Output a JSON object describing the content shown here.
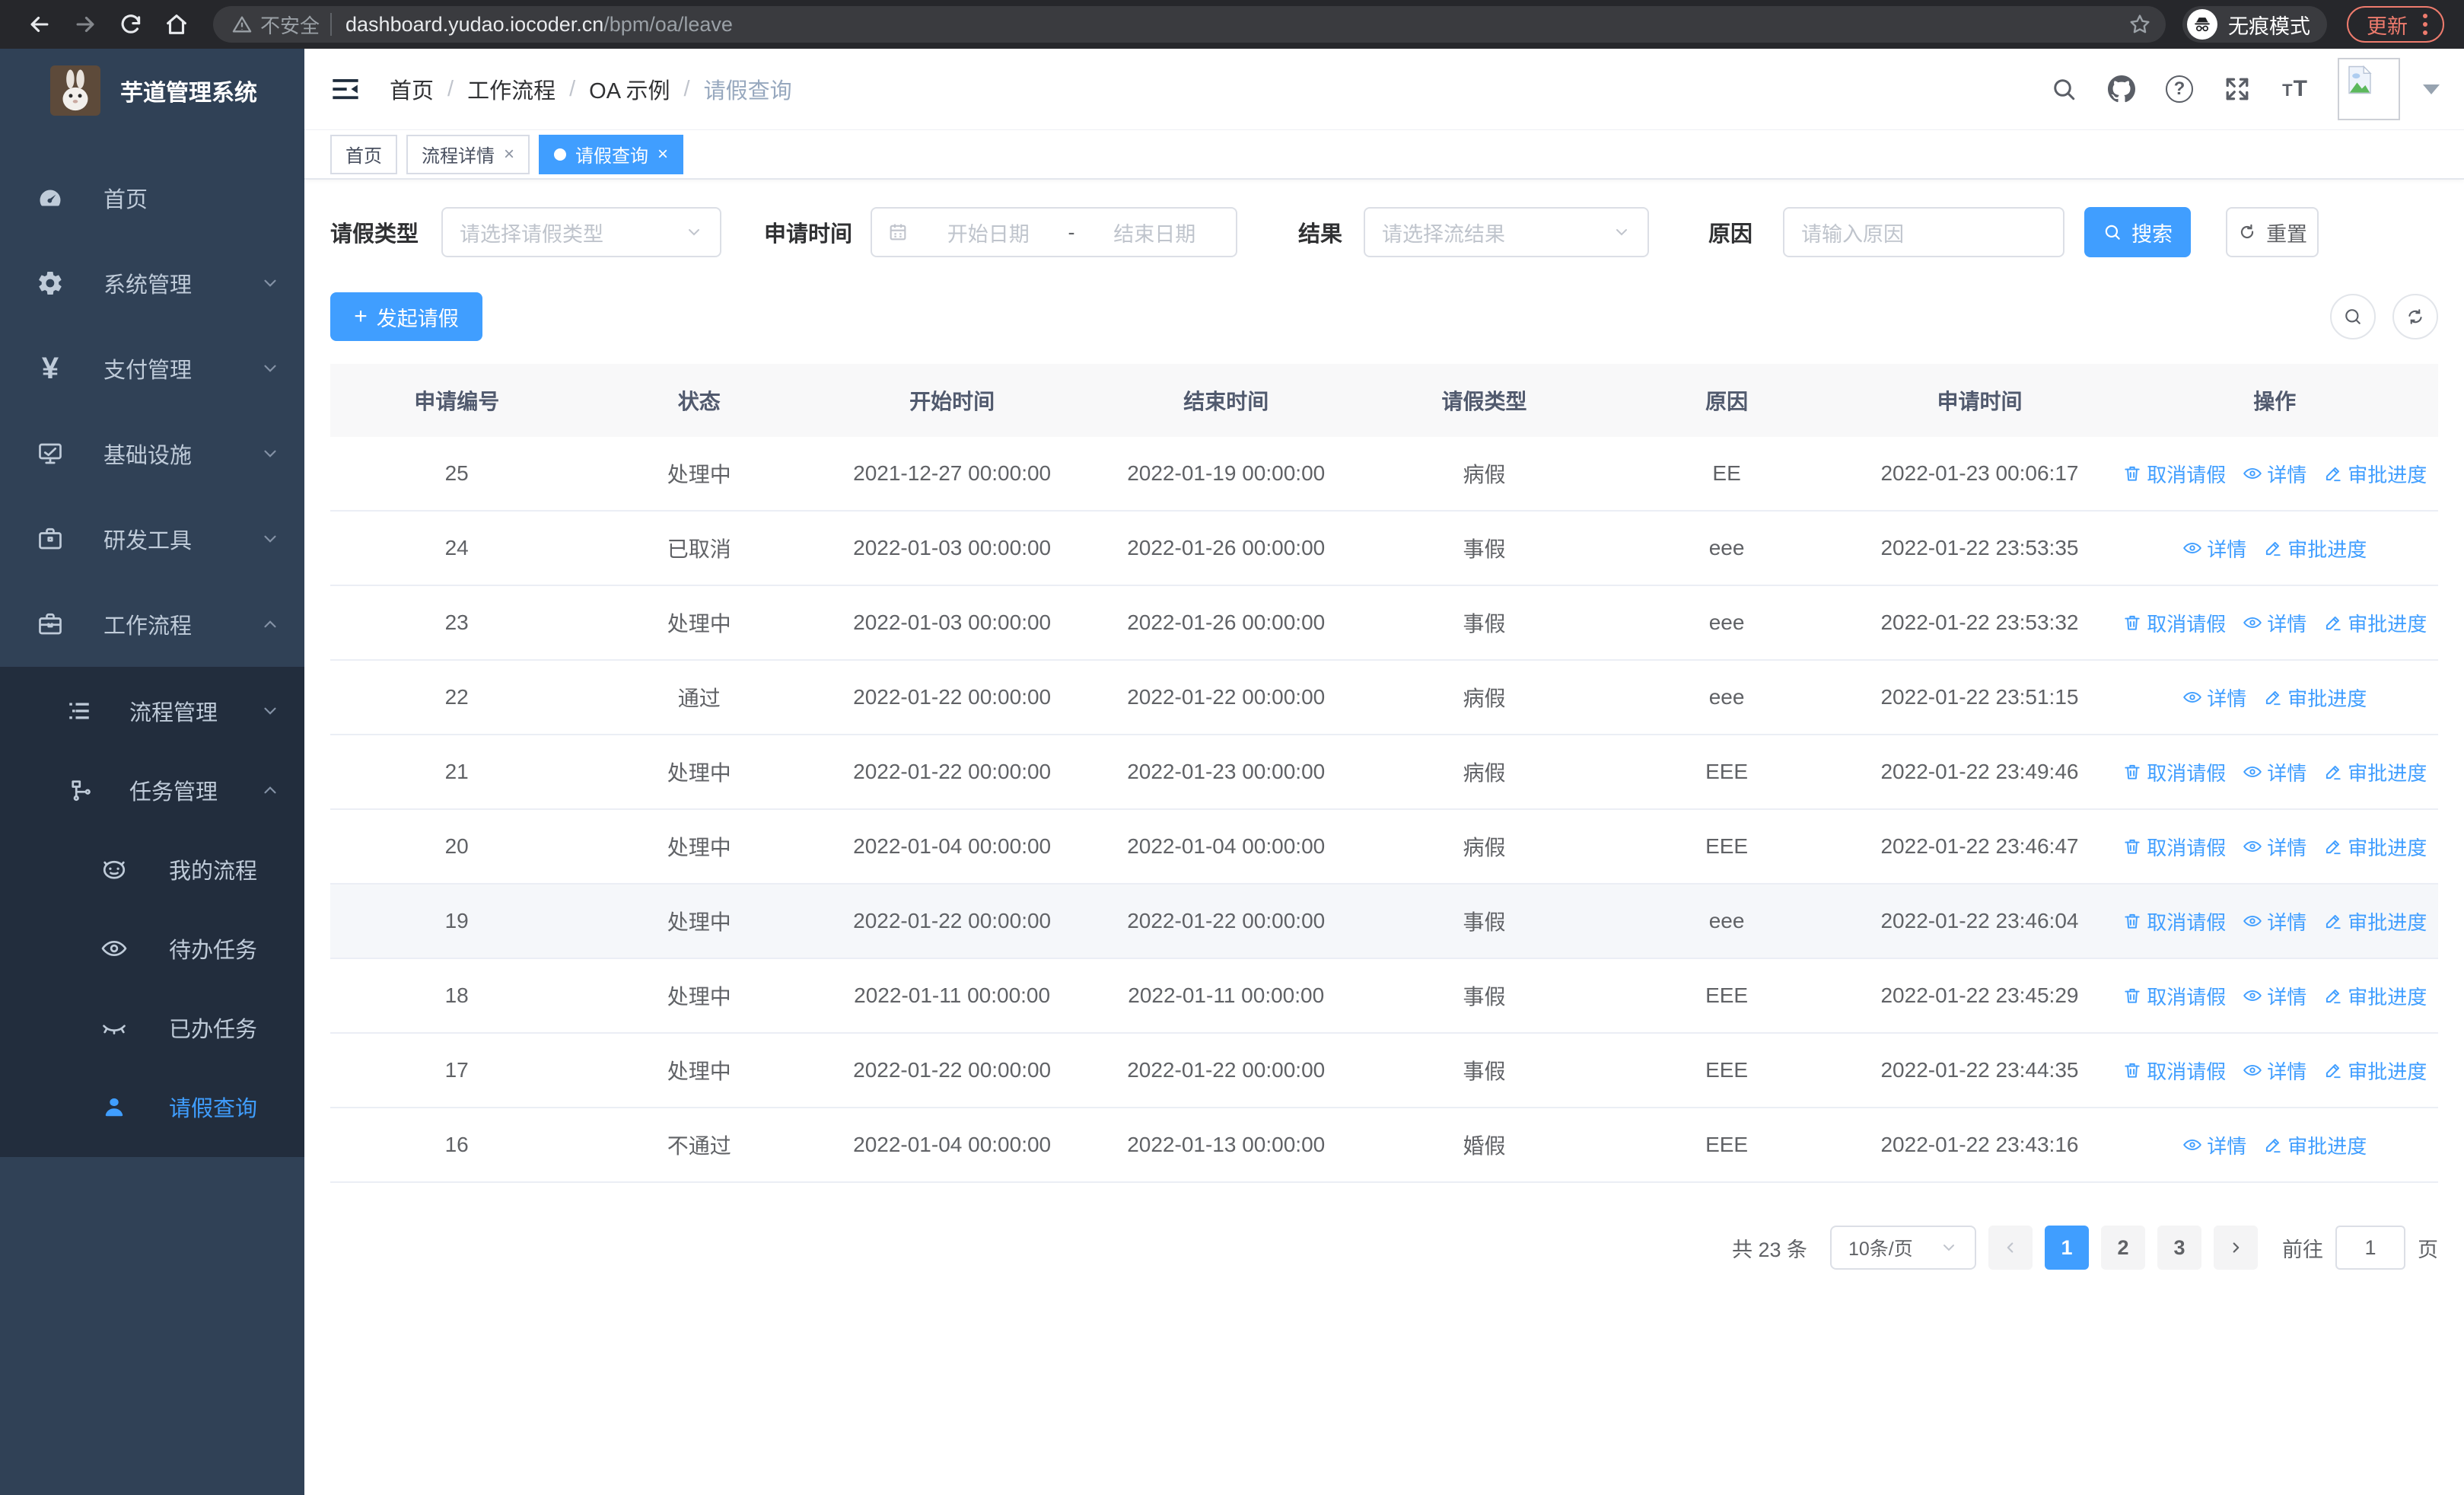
{
  "browser": {
    "security_label": "不安全",
    "url_host": "dashboard.yudao.iocoder.cn",
    "url_path": "/bpm/oa/leave",
    "incognito_label": "无痕模式",
    "update_label": "更新"
  },
  "sidebar": {
    "title": "芋道管理系统",
    "items": [
      {
        "label": "首页",
        "icon": "dashboard-icon"
      },
      {
        "label": "系统管理",
        "icon": "gear-icon"
      },
      {
        "label": "支付管理",
        "icon": "yen-icon"
      },
      {
        "label": "基础设施",
        "icon": "monitor-icon"
      },
      {
        "label": "研发工具",
        "icon": "toolbox-icon"
      },
      {
        "label": "工作流程",
        "icon": "briefcase-icon"
      }
    ],
    "submenu": [
      {
        "label": "流程管理",
        "icon": "list-icon"
      },
      {
        "label": "任务管理",
        "icon": "flow-icon"
      },
      {
        "label": "我的流程",
        "icon": "robot-face-icon"
      },
      {
        "label": "待办任务",
        "icon": "eye-open-icon"
      },
      {
        "label": "已办任务",
        "icon": "eye-closed-icon"
      },
      {
        "label": "请假查询",
        "icon": "user-icon",
        "active": true
      }
    ]
  },
  "header": {
    "breadcrumb": [
      "首页",
      "工作流程",
      "OA 示例",
      "请假查询"
    ],
    "separator": "/"
  },
  "tabs": [
    {
      "label": "首页",
      "closable": false,
      "active": false
    },
    {
      "label": "流程详情",
      "closable": true,
      "active": false
    },
    {
      "label": "请假查询",
      "closable": true,
      "active": true
    }
  ],
  "filters": {
    "leave_type_label": "请假类型",
    "leave_type_placeholder": "请选择请假类型",
    "apply_time_label": "申请时间",
    "start_date_placeholder": "开始日期",
    "date_separator": "-",
    "end_date_placeholder": "结束日期",
    "result_label": "结果",
    "result_placeholder": "请选择流结果",
    "reason_label": "原因",
    "reason_placeholder": "请输入原因",
    "search_label": "搜索",
    "reset_label": "重置"
  },
  "toolbar": {
    "create_label": "发起请假"
  },
  "table": {
    "columns": [
      "申请编号",
      "状态",
      "开始时间",
      "结束时间",
      "请假类型",
      "原因",
      "申请时间",
      "操作"
    ],
    "action_labels": {
      "cancel": "取消请假",
      "detail": "详情",
      "progress": "审批进度"
    },
    "rows": [
      {
        "id": "25",
        "status": "处理中",
        "start": "2021-12-27 00:00:00",
        "end": "2022-01-19 00:00:00",
        "type": "病假",
        "reason": "EE",
        "apply": "2022-01-23 00:06:17",
        "actions": [
          "cancel",
          "detail",
          "progress"
        ],
        "highlighted": false
      },
      {
        "id": "24",
        "status": "已取消",
        "start": "2022-01-03 00:00:00",
        "end": "2022-01-26 00:00:00",
        "type": "事假",
        "reason": "eee",
        "apply": "2022-01-22 23:53:35",
        "actions": [
          "detail",
          "progress"
        ],
        "highlighted": false
      },
      {
        "id": "23",
        "status": "处理中",
        "start": "2022-01-03 00:00:00",
        "end": "2022-01-26 00:00:00",
        "type": "事假",
        "reason": "eee",
        "apply": "2022-01-22 23:53:32",
        "actions": [
          "cancel",
          "detail",
          "progress"
        ],
        "highlighted": false
      },
      {
        "id": "22",
        "status": "通过",
        "start": "2022-01-22 00:00:00",
        "end": "2022-01-22 00:00:00",
        "type": "病假",
        "reason": "eee",
        "apply": "2022-01-22 23:51:15",
        "actions": [
          "detail",
          "progress"
        ],
        "highlighted": false
      },
      {
        "id": "21",
        "status": "处理中",
        "start": "2022-01-22 00:00:00",
        "end": "2022-01-23 00:00:00",
        "type": "病假",
        "reason": "EEE",
        "apply": "2022-01-22 23:49:46",
        "actions": [
          "cancel",
          "detail",
          "progress"
        ],
        "highlighted": false
      },
      {
        "id": "20",
        "status": "处理中",
        "start": "2022-01-04 00:00:00",
        "end": "2022-01-04 00:00:00",
        "type": "病假",
        "reason": "EEE",
        "apply": "2022-01-22 23:46:47",
        "actions": [
          "cancel",
          "detail",
          "progress"
        ],
        "highlighted": false
      },
      {
        "id": "19",
        "status": "处理中",
        "start": "2022-01-22 00:00:00",
        "end": "2022-01-22 00:00:00",
        "type": "事假",
        "reason": "eee",
        "apply": "2022-01-22 23:46:04",
        "actions": [
          "cancel",
          "detail",
          "progress"
        ],
        "highlighted": true
      },
      {
        "id": "18",
        "status": "处理中",
        "start": "2022-01-11 00:00:00",
        "end": "2022-01-11 00:00:00",
        "type": "事假",
        "reason": "EEE",
        "apply": "2022-01-22 23:45:29",
        "actions": [
          "cancel",
          "detail",
          "progress"
        ],
        "highlighted": false
      },
      {
        "id": "17",
        "status": "处理中",
        "start": "2022-01-22 00:00:00",
        "end": "2022-01-22 00:00:00",
        "type": "事假",
        "reason": "EEE",
        "apply": "2022-01-22 23:44:35",
        "actions": [
          "cancel",
          "detail",
          "progress"
        ],
        "highlighted": false
      },
      {
        "id": "16",
        "status": "不通过",
        "start": "2022-01-04 00:00:00",
        "end": "2022-01-13 00:00:00",
        "type": "婚假",
        "reason": "EEE",
        "apply": "2022-01-22 23:43:16",
        "actions": [
          "detail",
          "progress"
        ],
        "highlighted": false
      }
    ]
  },
  "pagination": {
    "total_label": "共 23 条",
    "page_size_label": "10条/页",
    "pages": [
      "1",
      "2",
      "3"
    ],
    "active_page": "1",
    "goto_label": "前往",
    "goto_value": "1",
    "page_suffix": "页"
  },
  "colors": {
    "accent": "#409EFF",
    "sidebar_bg": "#304156",
    "submenu_bg": "#222d3d",
    "table_header_bg": "#f8f8f9",
    "row_highlight": "#f5f7fa",
    "update_pill": "#ee7b6d"
  }
}
